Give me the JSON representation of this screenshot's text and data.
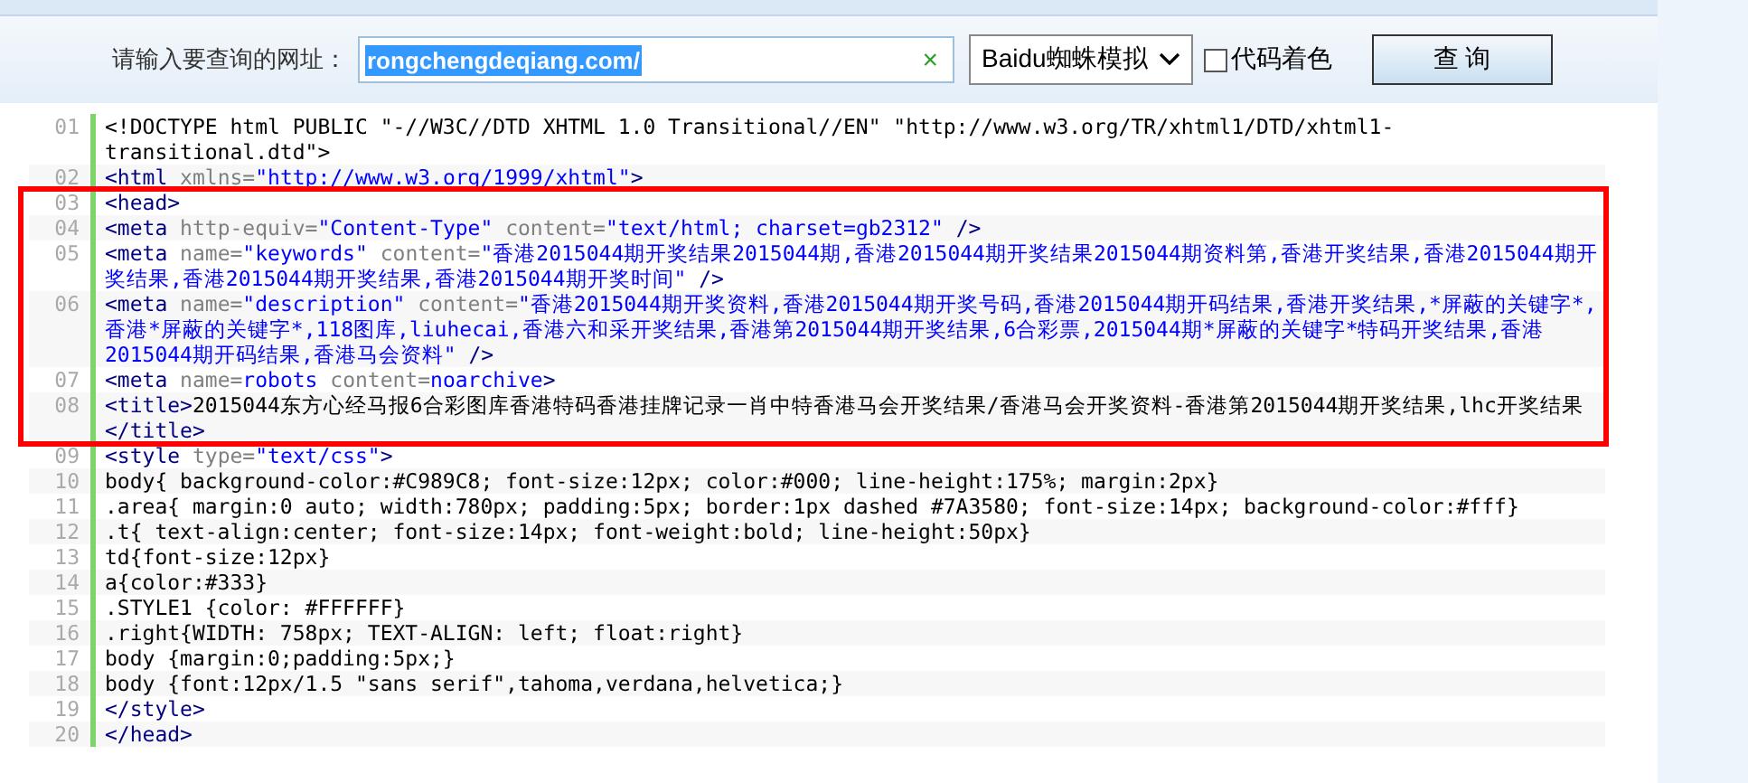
{
  "query": {
    "label": "请输入要查询的网址：",
    "value": "rongchengdeqiang.com/",
    "value_selected": true,
    "clear": "×",
    "engine": "Baidu蜘蛛模拟",
    "colorize": {
      "label": "代码着色",
      "checked": false
    },
    "submit": "查 询"
  },
  "code": {
    "lines": [
      {
        "number": "01",
        "highlighted": false,
        "tokens": [
          {
            "kind": "text",
            "text": "<!DOCTYPE html PUBLIC \"-//W3C//DTD XHTML 1.0 Transitional//EN\" \"http://www.w3.org/TR/xhtml1/DTD/xhtml1-transitional.dtd\">"
          }
        ]
      },
      {
        "number": "02",
        "highlighted": false,
        "tokens": [
          {
            "kind": "tag",
            "text": "<html"
          },
          {
            "kind": "attr",
            "text": " xmlns="
          },
          {
            "kind": "value",
            "text": "\"http://www.w3.org/1999/xhtml\""
          },
          {
            "kind": "tag",
            "text": ">"
          }
        ]
      },
      {
        "number": "03",
        "highlighted": true,
        "tokens": [
          {
            "kind": "tag",
            "text": "<head>"
          }
        ]
      },
      {
        "number": "04",
        "highlighted": true,
        "tokens": [
          {
            "kind": "tag",
            "text": "<meta"
          },
          {
            "kind": "attr",
            "text": " http-equiv="
          },
          {
            "kind": "value",
            "text": "\"Content-Type\""
          },
          {
            "kind": "attr",
            "text": " content="
          },
          {
            "kind": "value",
            "text": "\"text/html; charset=gb2312\""
          },
          {
            "kind": "tag",
            "text": " />"
          }
        ]
      },
      {
        "number": "05",
        "highlighted": true,
        "tokens": [
          {
            "kind": "tag",
            "text": "<meta"
          },
          {
            "kind": "attr",
            "text": " name="
          },
          {
            "kind": "value",
            "text": "\"keywords\""
          },
          {
            "kind": "attr",
            "text": " content="
          },
          {
            "kind": "value",
            "text": "\"香港2015044期开奖结果2015044期,香港2015044期开奖结果2015044期资料第,香港开奖结果,香港2015044期开奖结果,香港2015044期开奖结果,香港2015044期开奖时间\""
          },
          {
            "kind": "tag",
            "text": " />"
          }
        ]
      },
      {
        "number": "06",
        "highlighted": true,
        "tokens": [
          {
            "kind": "tag",
            "text": "<meta"
          },
          {
            "kind": "attr",
            "text": " name="
          },
          {
            "kind": "value",
            "text": "\"description\""
          },
          {
            "kind": "attr",
            "text": " content="
          },
          {
            "kind": "value",
            "text": "\"香港2015044期开奖资料,香港2015044期开奖号码,香港2015044期开码结果,香港开奖结果,*屏蔽的关键字*,香港*屏蔽的关键字*,118图库,liuhecai,香港六和采开奖结果,香港第2015044期开奖结果,6合彩票,2015044期*屏蔽的关键字*特码开奖结果,香港2015044期开码结果,香港马会资料\""
          },
          {
            "kind": "tag",
            "text": " />"
          }
        ]
      },
      {
        "number": "07",
        "highlighted": true,
        "tokens": [
          {
            "kind": "tag",
            "text": "<meta"
          },
          {
            "kind": "attr",
            "text": " name="
          },
          {
            "kind": "value",
            "text": "robots"
          },
          {
            "kind": "attr",
            "text": " content="
          },
          {
            "kind": "value",
            "text": "noarchive"
          },
          {
            "kind": "tag",
            "text": ">"
          }
        ]
      },
      {
        "number": "08",
        "highlighted": true,
        "tokens": [
          {
            "kind": "tag",
            "text": "<title>"
          },
          {
            "kind": "text",
            "text": "2015044东方心经马报6合彩图库香港特码香港挂牌记录一肖中特香港马会开奖结果/香港马会开奖资料-香港第2015044期开奖结果,lhc开奖结果"
          },
          {
            "kind": "tag",
            "text": "</title>"
          }
        ]
      },
      {
        "number": "09",
        "highlighted": false,
        "tokens": [
          {
            "kind": "tag",
            "text": "<style"
          },
          {
            "kind": "attr",
            "text": " type="
          },
          {
            "kind": "value",
            "text": "\"text/css\""
          },
          {
            "kind": "tag",
            "text": ">"
          }
        ]
      },
      {
        "number": "10",
        "highlighted": false,
        "tokens": [
          {
            "kind": "text",
            "text": "body{ background-color:#C989C8; font-size:12px; color:#000; line-height:175%; margin:2px}"
          }
        ]
      },
      {
        "number": "11",
        "highlighted": false,
        "tokens": [
          {
            "kind": "text",
            "text": ".area{ margin:0 auto; width:780px; padding:5px; border:1px dashed #7A3580; font-size:14px; background-color:#fff}"
          }
        ]
      },
      {
        "number": "12",
        "highlighted": false,
        "tokens": [
          {
            "kind": "text",
            "text": ".t{ text-align:center; font-size:14px; font-weight:bold; line-height:50px}"
          }
        ]
      },
      {
        "number": "13",
        "highlighted": false,
        "tokens": [
          {
            "kind": "text",
            "text": "td{font-size:12px}"
          }
        ]
      },
      {
        "number": "14",
        "highlighted": false,
        "tokens": [
          {
            "kind": "text",
            "text": "a{color:#333}"
          }
        ]
      },
      {
        "number": "15",
        "highlighted": false,
        "tokens": [
          {
            "kind": "text",
            "text": ".STYLE1 {color: #FFFFFF}"
          }
        ]
      },
      {
        "number": "16",
        "highlighted": false,
        "tokens": [
          {
            "kind": "text",
            "text": ".right{WIDTH: 758px; TEXT-ALIGN: left; float:right}"
          }
        ]
      },
      {
        "number": "17",
        "highlighted": false,
        "tokens": [
          {
            "kind": "text",
            "text": "body {margin:0;padding:5px;}"
          }
        ]
      },
      {
        "number": "18",
        "highlighted": false,
        "tokens": [
          {
            "kind": "text",
            "text": "body {font:12px/1.5 \"sans serif\",tahoma,verdana,helvetica;}"
          }
        ]
      },
      {
        "number": "19",
        "highlighted": false,
        "tokens": [
          {
            "kind": "tag",
            "text": "</style>"
          }
        ]
      },
      {
        "number": "20",
        "highlighted": false,
        "tokens": [
          {
            "kind": "tag",
            "text": "</head>"
          }
        ]
      }
    ]
  }
}
